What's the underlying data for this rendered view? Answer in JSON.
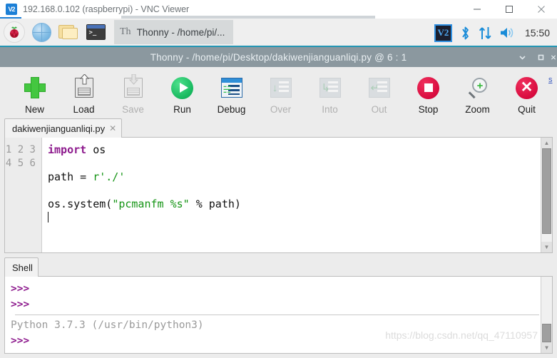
{
  "vnc_window": {
    "title": "192.168.0.102 (raspberrypi) - VNC Viewer",
    "logo_text": "V2",
    "minimize_label": "minimize",
    "maximize_label": "maximize",
    "close_label": "close"
  },
  "taskbar": {
    "launchers": [
      {
        "name": "raspberry-pi-menu",
        "label": "Menu"
      },
      {
        "name": "web-browser",
        "label": "Web Browser"
      },
      {
        "name": "file-manager",
        "label": "File Manager"
      },
      {
        "name": "terminal",
        "label": "Terminal",
        "prompt": ">_"
      }
    ],
    "task_button": {
      "icon": "Th",
      "label": "Thonny  -  /home/pi/..."
    },
    "tray": {
      "vnc_label": "V2",
      "bluetooth": "bluetooth-icon",
      "network": "network-icon",
      "volume": "volume-icon",
      "clock": "15:50"
    }
  },
  "thonny": {
    "title": "Thonny  -  /home/pi/Desktop/dakiwenjianguanliqi.py  @  6 : 1",
    "window_buttons": {
      "minimize": "minimize",
      "maximize": "maximize",
      "close": "close"
    },
    "toolbar": [
      {
        "label": "New",
        "icon": "new-file-icon",
        "enabled": true
      },
      {
        "label": "Load",
        "icon": "load-file-icon",
        "enabled": true
      },
      {
        "label": "Save",
        "icon": "save-file-icon",
        "enabled": false
      },
      {
        "label": "Run",
        "icon": "run-icon",
        "enabled": true
      },
      {
        "label": "Debug",
        "icon": "debug-icon",
        "enabled": true
      },
      {
        "label": "Over",
        "icon": "step-over-icon",
        "enabled": false
      },
      {
        "label": "Into",
        "icon": "step-into-icon",
        "enabled": false
      },
      {
        "label": "Out",
        "icon": "step-out-icon",
        "enabled": false
      },
      {
        "label": "Stop",
        "icon": "stop-icon",
        "enabled": true
      },
      {
        "label": "Zoom",
        "icon": "zoom-icon",
        "enabled": true
      },
      {
        "label": "Quit",
        "icon": "quit-icon",
        "enabled": true
      }
    ],
    "editor": {
      "tab_label": "dakiwenjianguanliqi.py",
      "tab_close": "✕",
      "line_numbers": [
        "1",
        "2",
        "3",
        "4",
        "5",
        "6"
      ],
      "lines": [
        {
          "n": "1",
          "parts": [
            {
              "t": "import",
              "c": "kw"
            },
            {
              "t": " os",
              "c": ""
            }
          ]
        },
        {
          "n": "2",
          "parts": []
        },
        {
          "n": "3",
          "parts": [
            {
              "t": "path = ",
              "c": ""
            },
            {
              "t": "r'./'",
              "c": "str"
            }
          ]
        },
        {
          "n": "4",
          "parts": []
        },
        {
          "n": "5",
          "parts": [
            {
              "t": "os.system(",
              "c": ""
            },
            {
              "t": "\"pcmanfm %s\"",
              "c": "str"
            },
            {
              "t": " % path)",
              "c": ""
            }
          ]
        },
        {
          "n": "6",
          "parts": []
        }
      ],
      "plain_text": "import os\n\npath = r'./'\n\nos.system(\"pcmanfm %s\" % path)\n"
    },
    "shell": {
      "tab_label": "Shell",
      "lines": [
        {
          "kind": "prompt",
          "text": ">>>"
        },
        {
          "kind": "prompt",
          "text": ">>>"
        },
        {
          "kind": "rule",
          "text": ""
        },
        {
          "kind": "system",
          "text": "Python 3.7.3 (/usr/bin/python3)"
        },
        {
          "kind": "prompt",
          "text": ">>>"
        }
      ]
    }
  },
  "watermark": {
    "text": "https://blog.csdn.net/qq_47110957",
    "top_fragment": "s"
  },
  "colors": {
    "taskbar_bg": "#efefef",
    "taskbar_accent": "#2196b4",
    "thonny_titlebar": "#8b989f",
    "keyword": "#8d1a8d",
    "string": "#149414",
    "run_green": "#17b85e",
    "stop_red": "#d80b3e"
  }
}
